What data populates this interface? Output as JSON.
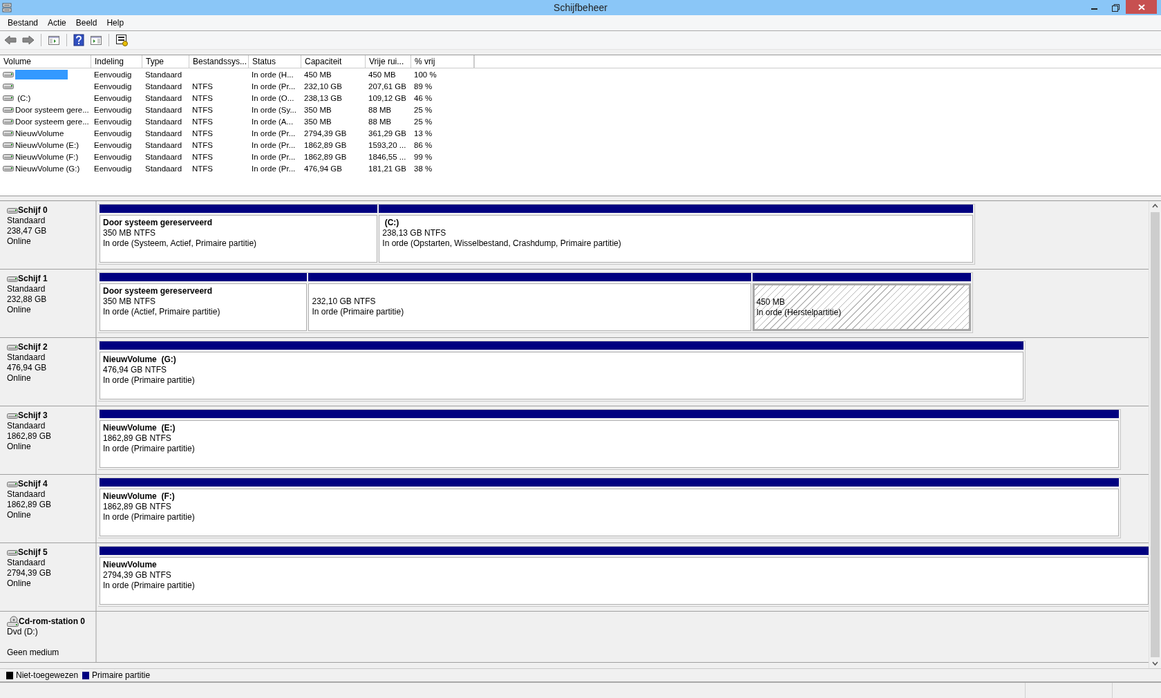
{
  "window": {
    "title": "Schijfbeheer"
  },
  "menu": [
    {
      "label": "Bestand"
    },
    {
      "label": "Actie"
    },
    {
      "label": "Beeld"
    },
    {
      "label": "Help"
    }
  ],
  "volumes": {
    "columns": [
      "Volume",
      "Indeling",
      "Type",
      "Bestandssys...",
      "Status",
      "Capaciteit",
      "Vrije rui...",
      "% vrij"
    ],
    "rows": [
      {
        "selected": true,
        "cells": [
          "",
          "Eenvoudig",
          "Standaard",
          "",
          "In orde (H...",
          "450 MB",
          "450 MB",
          "100 %"
        ]
      },
      {
        "selected": false,
        "cells": [
          "",
          "Eenvoudig",
          "Standaard",
          "NTFS",
          "In orde (Pr...",
          "232,10 GB",
          "207,61 GB",
          "89 %"
        ]
      },
      {
        "selected": false,
        "cells": [
          " (C:)",
          "Eenvoudig",
          "Standaard",
          "NTFS",
          "In orde (O...",
          "238,13 GB",
          "109,12 GB",
          "46 %"
        ]
      },
      {
        "selected": false,
        "cells": [
          "Door systeem gere...",
          "Eenvoudig",
          "Standaard",
          "NTFS",
          "In orde (Sy...",
          "350 MB",
          "88 MB",
          "25 %"
        ]
      },
      {
        "selected": false,
        "cells": [
          "Door systeem gere...",
          "Eenvoudig",
          "Standaard",
          "NTFS",
          "In orde (A...",
          "350 MB",
          "88 MB",
          "25 %"
        ]
      },
      {
        "selected": false,
        "cells": [
          "NieuwVolume",
          "Eenvoudig",
          "Standaard",
          "NTFS",
          "In orde (Pr...",
          "2794,39 GB",
          "361,29 GB",
          "13 %"
        ]
      },
      {
        "selected": false,
        "cells": [
          "NieuwVolume (E:)",
          "Eenvoudig",
          "Standaard",
          "NTFS",
          "In orde (Pr...",
          "1862,89 GB",
          "1593,20 ...",
          "86 %"
        ]
      },
      {
        "selected": false,
        "cells": [
          "NieuwVolume (F:)",
          "Eenvoudig",
          "Standaard",
          "NTFS",
          "In orde (Pr...",
          "1862,89 GB",
          "1846,55 ...",
          "99 %"
        ]
      },
      {
        "selected": false,
        "cells": [
          "NieuwVolume (G:)",
          "Eenvoudig",
          "Standaard",
          "NTFS",
          "In orde (Pr...",
          "476,94 GB",
          "181,21 GB",
          "38 %"
        ]
      }
    ]
  },
  "disks": [
    {
      "kind": "disk",
      "name": "Schijf 0",
      "type": "Standaard",
      "size": "238,47 GB",
      "status": "Online",
      "partitions": [
        {
          "kind": "primary",
          "title": "Door systeem gereserveerd",
          "size": "350 MB NTFS",
          "status": "In orde (Systeem, Actief, Primaire partitie)"
        },
        {
          "kind": "primary",
          "title": " (C:)",
          "size": "238,13 GB NTFS",
          "status": "In orde (Opstarten, Wisselbestand, Crashdump, Primaire partitie)"
        }
      ]
    },
    {
      "kind": "disk",
      "name": "Schijf 1",
      "type": "Standaard",
      "size": "232,88 GB",
      "status": "Online",
      "partitions": [
        {
          "kind": "primary",
          "title": "Door systeem gereserveerd",
          "size": "350 MB NTFS",
          "status": "In orde (Actief, Primaire partitie)"
        },
        {
          "kind": "primary",
          "size": "232,10 GB NTFS",
          "status": "In orde (Primaire partitie)"
        },
        {
          "kind": "recovery",
          "size": "450 MB",
          "status": "In orde (Herstelpartitie)"
        }
      ]
    },
    {
      "kind": "disk",
      "name": "Schijf 2",
      "type": "Standaard",
      "size": "476,94 GB",
      "status": "Online",
      "partitions": [
        {
          "kind": "primary",
          "title": "NieuwVolume  (G:)",
          "size": "476,94 GB NTFS",
          "status": "In orde (Primaire partitie)"
        }
      ]
    },
    {
      "kind": "disk",
      "name": "Schijf 3",
      "type": "Standaard",
      "size": "1862,89 GB",
      "status": "Online",
      "partitions": [
        {
          "kind": "primary",
          "title": "NieuwVolume  (E:)",
          "size": "1862,89 GB NTFS",
          "status": "In orde (Primaire partitie)"
        }
      ]
    },
    {
      "kind": "disk",
      "name": "Schijf 4",
      "type": "Standaard",
      "size": "1862,89 GB",
      "status": "Online",
      "partitions": [
        {
          "kind": "primary",
          "title": "NieuwVolume  (F:)",
          "size": "1862,89 GB NTFS",
          "status": "In orde (Primaire partitie)"
        }
      ]
    },
    {
      "kind": "disk",
      "name": "Schijf 5",
      "type": "Standaard",
      "size": "2794,39 GB",
      "status": "Online",
      "partitions": [
        {
          "kind": "primary",
          "title": "NieuwVolume",
          "size": "2794,39 GB NTFS",
          "status": "In orde (Primaire partitie)"
        }
      ]
    },
    {
      "kind": "cdrom",
      "name": "Cd-rom-station 0",
      "type": "Dvd (D:)",
      "status": "Geen medium"
    }
  ],
  "legend": [
    {
      "label": "Niet-toegewezen",
      "color": "#000000"
    },
    {
      "label": "Primaire partitie",
      "color": "#000080"
    }
  ]
}
